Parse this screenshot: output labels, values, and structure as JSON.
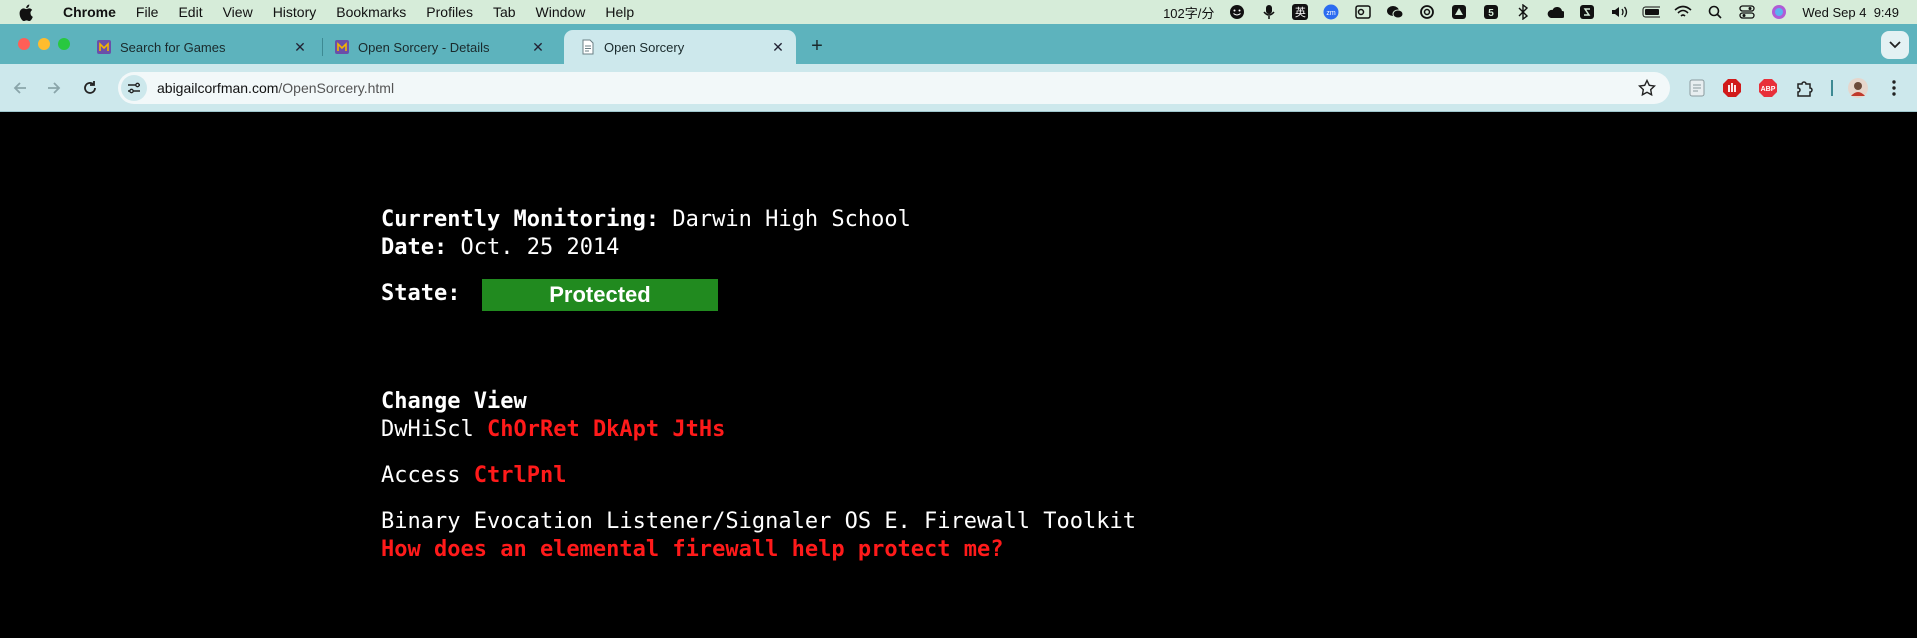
{
  "menubar": {
    "app_name": "Chrome",
    "items": [
      "File",
      "Edit",
      "View",
      "History",
      "Bookmarks",
      "Profiles",
      "Tab",
      "Window",
      "Help"
    ],
    "input_rate": "102字/分",
    "ime_label": "英",
    "datetime": "Wed Sep 4  9:49"
  },
  "tabs": [
    {
      "title": "Search for Games",
      "active": false
    },
    {
      "title": "Open Sorcery - Details",
      "active": false
    },
    {
      "title": "Open Sorcery",
      "active": true
    }
  ],
  "toolbar": {
    "url_host": "abigailcorfman.com",
    "url_path": "/OpenSorcery.html"
  },
  "page": {
    "monitoring_label": "Currently Monitoring:",
    "monitoring_value": "Darwin High School",
    "date_label": "Date:",
    "date_value": "Oct. 25 2014",
    "state_label": "State:",
    "state_value": "Protected",
    "change_view_heading": "Change View",
    "view_current": "DwHiScl",
    "view_links": [
      "ChOrRet",
      "DkApt",
      "JtHs"
    ],
    "access_label": "Access",
    "access_link": "CtrlPnl",
    "toolkit_title": "Binary Evocation Listener/Signaler OS E. Firewall Toolkit",
    "faq_link": "How does an elemental firewall help protect me?"
  },
  "colors": {
    "menubar_bg": "#d6ecd9",
    "tabstrip_bg": "#5db3bd",
    "toolbar_bg": "#cde8ec",
    "page_bg": "#000000",
    "link_red": "#ff1a1a",
    "state_green": "#218a1f"
  }
}
